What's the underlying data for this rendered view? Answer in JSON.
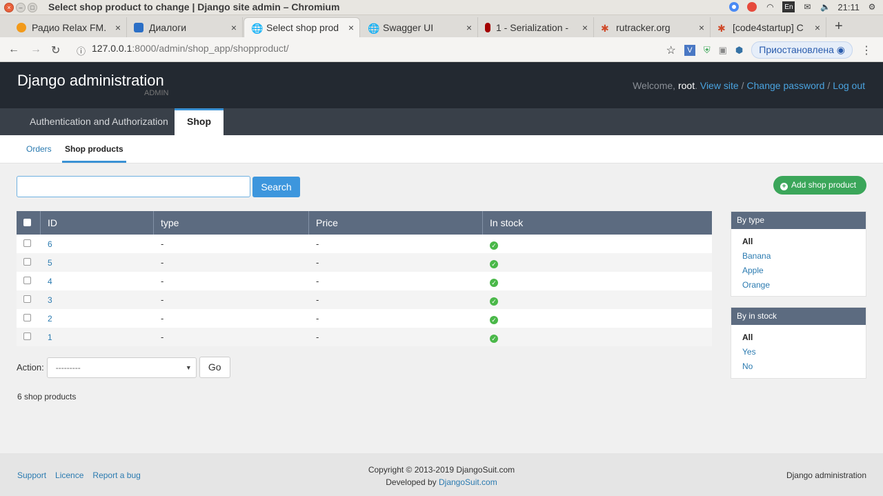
{
  "os": {
    "window_title": "Select shop product to change | Django site admin – Chromium",
    "keyboard_layout": "En",
    "clock": "21:11"
  },
  "browser": {
    "tabs": [
      {
        "label": "Радио Relax FM."
      },
      {
        "label": "Диалоги"
      },
      {
        "label": "Select shop prod"
      },
      {
        "label": "Swagger UI"
      },
      {
        "label": "1 - Serialization - "
      },
      {
        "label": "rutracker.org"
      },
      {
        "label": "[code4startup] C"
      }
    ],
    "url_host": "127.0.0.1",
    "url_rest": ":8000/admin/shop_app/shopproduct/",
    "profile_status": "Приостановлена"
  },
  "header": {
    "brand": "Django administration",
    "brand_sub": "ADMIN",
    "welcome": "Welcome,",
    "username": "root",
    "view_site": "View site",
    "change_password": "Change password",
    "log_out": "Log out"
  },
  "menu": {
    "items": [
      {
        "label": "Authentication and Authorization"
      },
      {
        "label": "Shop"
      }
    ]
  },
  "submenu": {
    "items": [
      {
        "label": "Orders"
      },
      {
        "label": "Shop products"
      }
    ]
  },
  "toolbar": {
    "search_value": "",
    "search_button": "Search",
    "add_button": "Add shop product"
  },
  "table": {
    "columns": [
      "ID",
      "type",
      "Price",
      "In stock"
    ],
    "rows": [
      {
        "id": "6",
        "type": "-",
        "price": "-",
        "in_stock": true
      },
      {
        "id": "5",
        "type": "-",
        "price": "-",
        "in_stock": true
      },
      {
        "id": "4",
        "type": "-",
        "price": "-",
        "in_stock": true
      },
      {
        "id": "3",
        "type": "-",
        "price": "-",
        "in_stock": true
      },
      {
        "id": "2",
        "type": "-",
        "price": "-",
        "in_stock": true
      },
      {
        "id": "1",
        "type": "-",
        "price": "-",
        "in_stock": true
      }
    ]
  },
  "actions": {
    "label": "Action:",
    "selected": "---------",
    "go": "Go"
  },
  "result_count": "6 shop products",
  "filters": [
    {
      "title": "By type",
      "items": [
        "All",
        "Banana",
        "Apple",
        "Orange"
      ]
    },
    {
      "title": "By in stock",
      "items": [
        "All",
        "Yes",
        "No"
      ]
    }
  ],
  "footer": {
    "links": [
      "Support",
      "Licence",
      "Report a bug"
    ],
    "copyright": "Copyright © 2013-2019 DjangoSuit.com",
    "developed_by": "Developed by",
    "developer": "DjangoSuit.com",
    "right": "Django administration"
  },
  "colors": {
    "header_bg": "#232931",
    "menu_bg": "#394049",
    "accent": "#3d96dd",
    "add_green": "#3ba65a",
    "table_head": "#5c6b80"
  }
}
